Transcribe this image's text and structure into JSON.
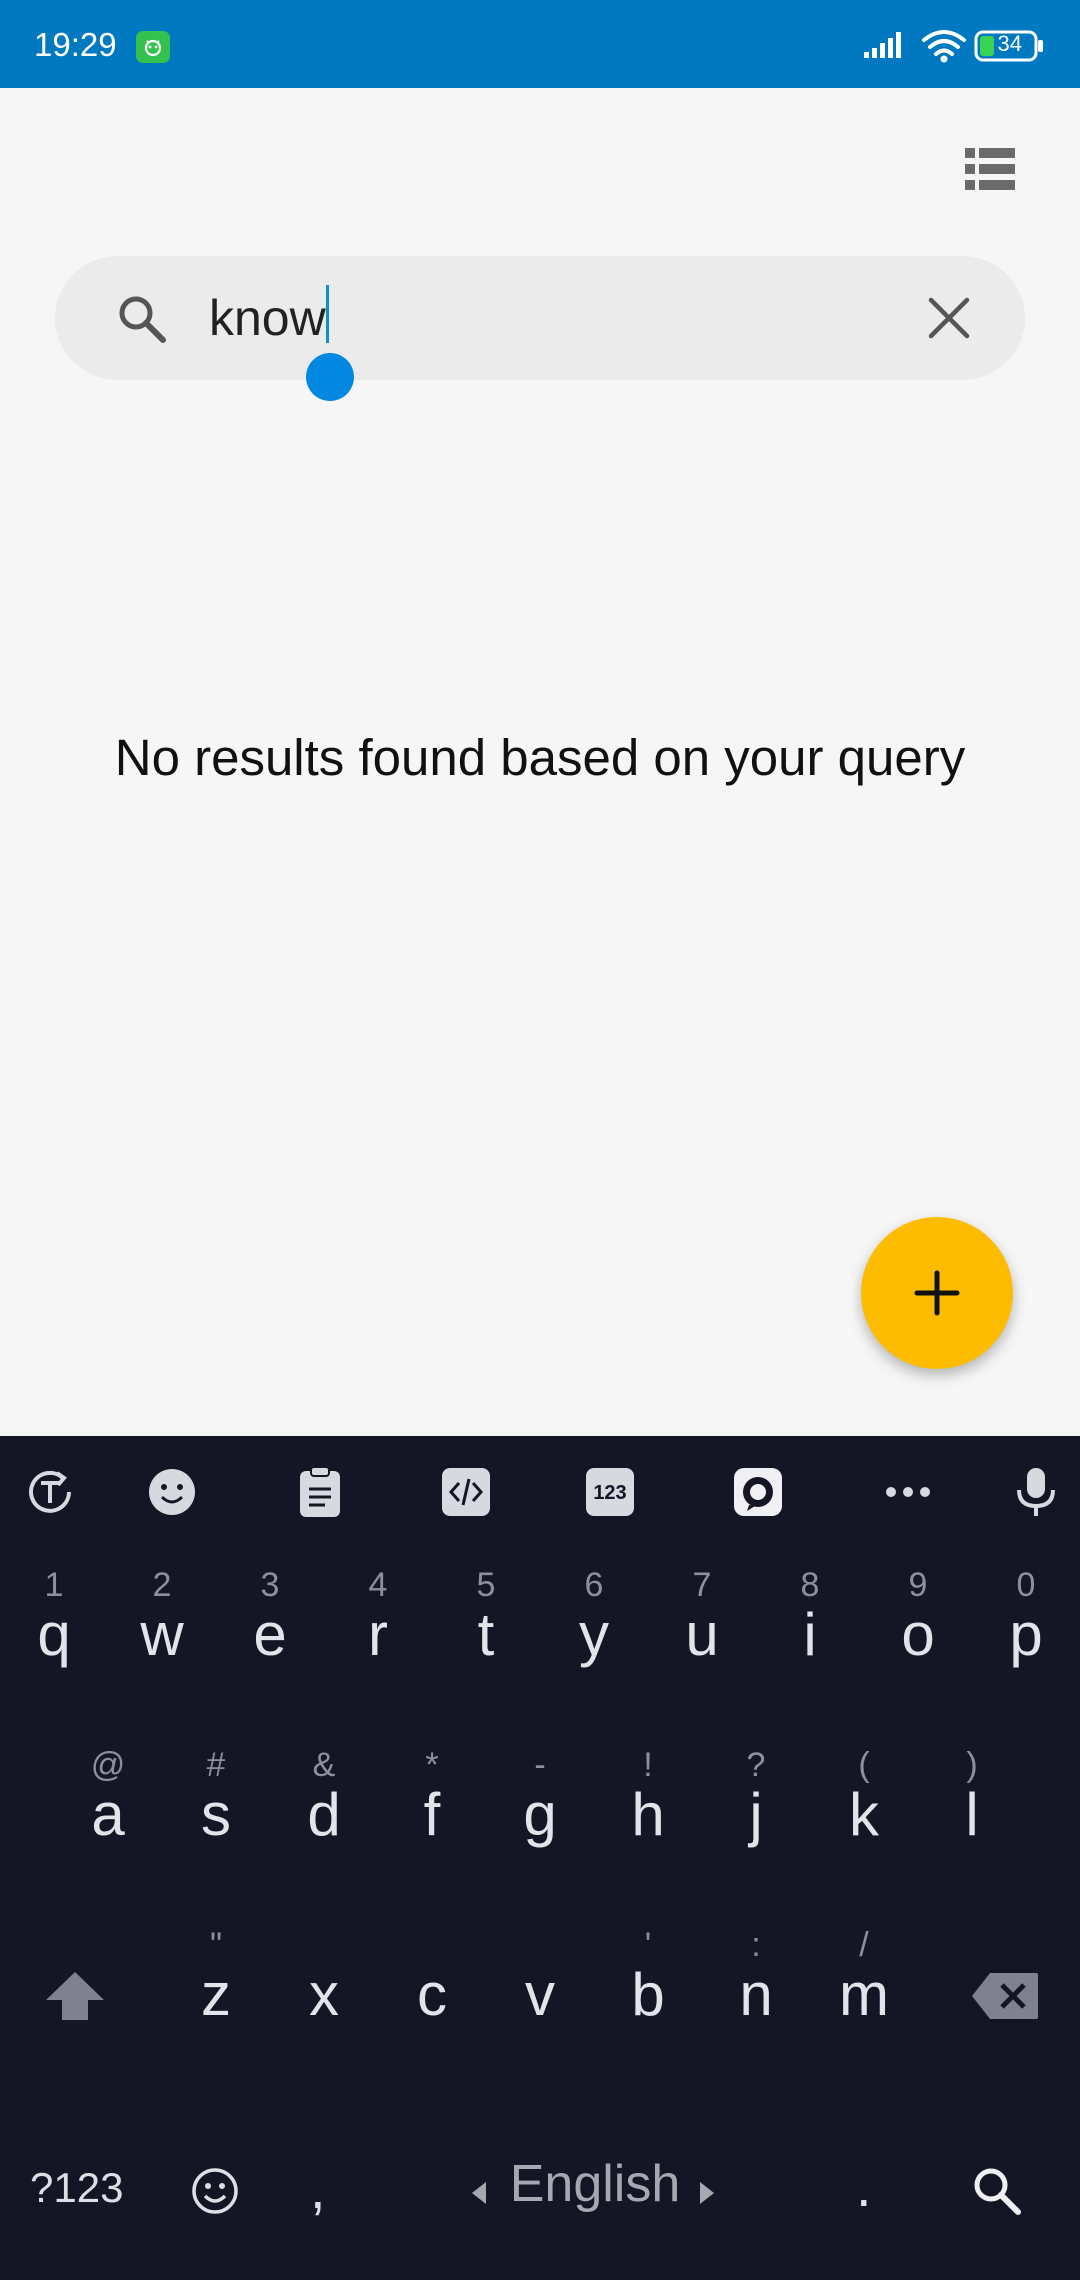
{
  "status_bar": {
    "time": "19:29",
    "battery": "34",
    "background": "#0079c0"
  },
  "header": {
    "list_view_icon": "list-view-icon"
  },
  "search": {
    "query": "know",
    "search_icon": "search-icon",
    "clear_icon": "close-icon"
  },
  "empty_state": {
    "message": "No results found based on your query"
  },
  "fab": {
    "icon": "plus-icon",
    "color": "#fdbc00"
  },
  "keyboard": {
    "toolbar_icons": [
      "translate-icon",
      "emoji-icon",
      "clipboard-icon",
      "code-icon",
      "numbers-icon",
      "chat-icon",
      "more-icon",
      "mic-icon"
    ],
    "row1": [
      {
        "hint": "1",
        "key": "q"
      },
      {
        "hint": "2",
        "key": "w"
      },
      {
        "hint": "3",
        "key": "e"
      },
      {
        "hint": "4",
        "key": "r"
      },
      {
        "hint": "5",
        "key": "t"
      },
      {
        "hint": "6",
        "key": "y"
      },
      {
        "hint": "7",
        "key": "u"
      },
      {
        "hint": "8",
        "key": "i"
      },
      {
        "hint": "9",
        "key": "o"
      },
      {
        "hint": "0",
        "key": "p"
      }
    ],
    "row2": [
      {
        "hint": "@",
        "key": "a"
      },
      {
        "hint": "#",
        "key": "s"
      },
      {
        "hint": "&",
        "key": "d"
      },
      {
        "hint": "*",
        "key": "f"
      },
      {
        "hint": "-",
        "key": "g"
      },
      {
        "hint": "!",
        "key": "h"
      },
      {
        "hint": "?",
        "key": "j"
      },
      {
        "hint": "(",
        "key": "k"
      },
      {
        "hint": ")",
        "key": "l"
      }
    ],
    "row3": [
      {
        "hint": "\"",
        "key": "z"
      },
      {
        "hint": "",
        "key": "x"
      },
      {
        "hint": "",
        "key": "c"
      },
      {
        "hint": "",
        "key": "v"
      },
      {
        "hint": "'",
        "key": "b"
      },
      {
        "hint": ":",
        "key": "n"
      },
      {
        "hint": "/",
        "key": "m"
      }
    ],
    "symbols_key": "?123",
    "comma_key": ",",
    "space_label": "English",
    "period_key": ".",
    "enter_icon": "search-icon",
    "shift_icon": "shift-icon",
    "backspace_icon": "backspace-icon",
    "background": "#141625"
  }
}
